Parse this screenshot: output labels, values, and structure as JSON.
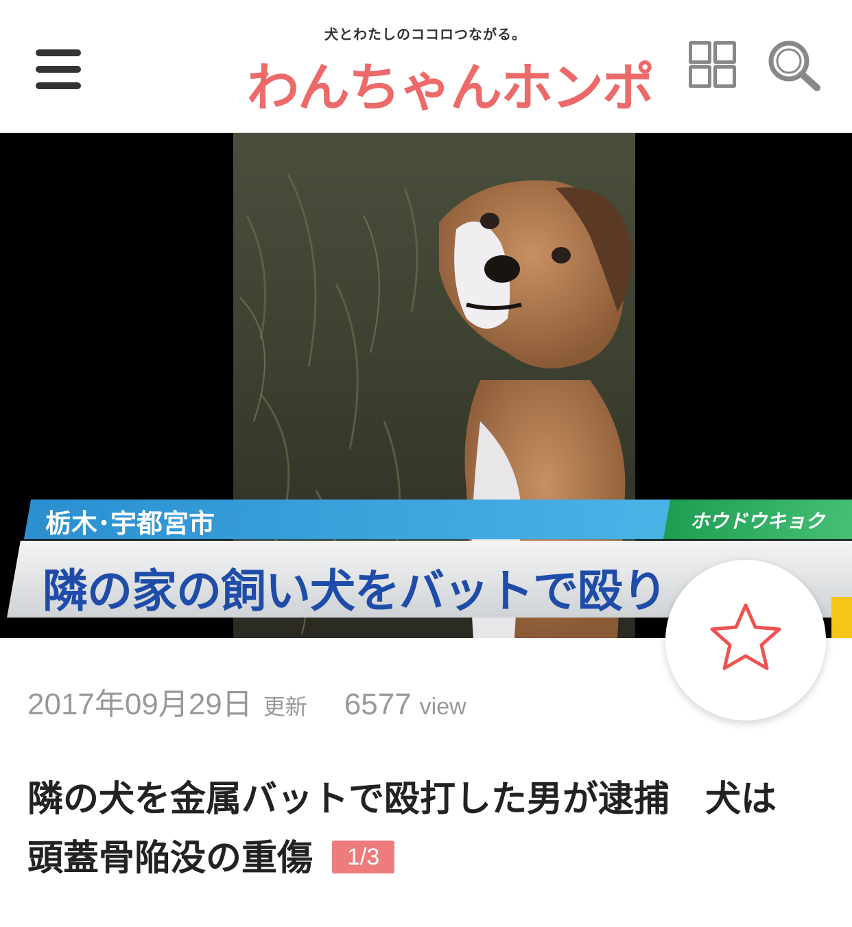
{
  "header": {
    "menu_icon": "hamburger-menu-icon",
    "logo_tagline": "犬とわたしのココロつながる。",
    "logo_title": "わんちゃんホンポ",
    "grid_icon": "grid-view-icon",
    "search_icon": "search-icon",
    "logo_color": "#ec6a69"
  },
  "hero": {
    "location_caption": "栃木･宇都宮市",
    "station_caption": "ホウドウキョク",
    "headline_caption": "隣の家の飼い犬をバットで殴り",
    "photo_subject": "dog-photo"
  },
  "favorite": {
    "icon": "star-outline-icon",
    "color": "#ef5350"
  },
  "article": {
    "date": "2017年09月29日",
    "updated_label": "更新",
    "views": "6577",
    "views_label": "view",
    "title": "隣の犬を金属バットで殴打した男が逮捕　犬は頭蓋骨陥没の重傷",
    "page_indicator": "1/3",
    "badge_color": "#ee7c7c"
  }
}
